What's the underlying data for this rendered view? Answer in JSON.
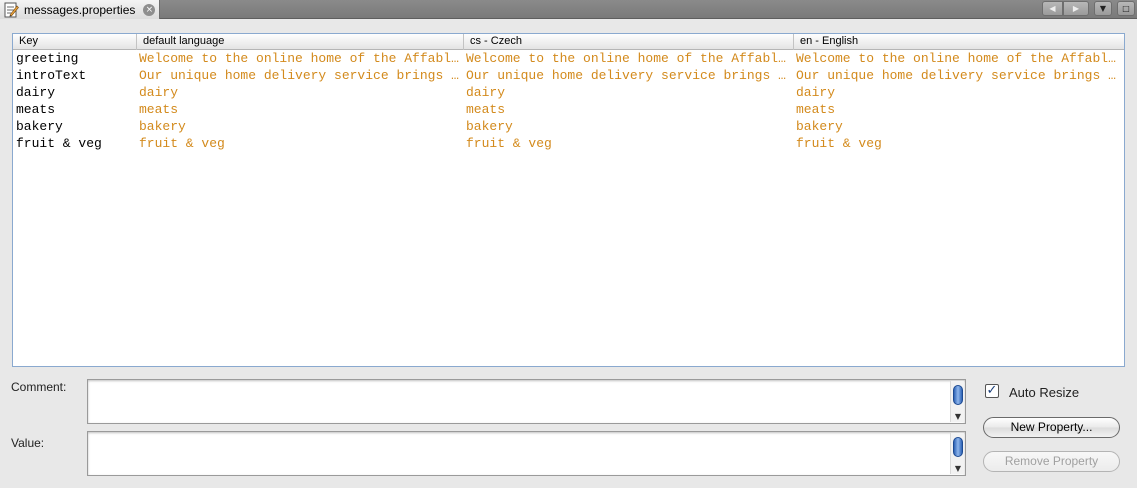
{
  "tab": {
    "title": "messages.properties",
    "close_glyph": "×",
    "icon": "properties-file-icon"
  },
  "tab_controls": {
    "prev": "◀",
    "next": "▶",
    "menu": "▼",
    "maximize": "□"
  },
  "table": {
    "columns": [
      "Key",
      "default language",
      "cs - Czech",
      "en - English"
    ],
    "rows": [
      [
        "greeting",
        "Welcome to the online home of the Affable Bean Green Grocer.",
        "Welcome to the online home of the Affable Bean Green Grocer.",
        "Welcome to the online home of the Affable Bean Green Grocer."
      ],
      [
        "introText",
        "Our unique home delivery service brings you fresh organic produce.",
        "Our unique home delivery service brings you fresh organic produce.",
        "Our unique home delivery service brings you fresh organic produce."
      ],
      [
        "dairy",
        "dairy",
        "dairy",
        "dairy"
      ],
      [
        "meats",
        "meats",
        "meats",
        "meats"
      ],
      [
        "bakery",
        "bakery",
        "bakery",
        "bakery"
      ],
      [
        "fruit & veg",
        "fruit & veg",
        "fruit & veg",
        "fruit & veg"
      ]
    ]
  },
  "form": {
    "comment_label": "Comment:",
    "comment_value": "",
    "value_label": "Value:",
    "value_value": "",
    "auto_resize_label": "Auto Resize",
    "auto_resize_checked": true,
    "new_property_label": "New Property...",
    "remove_property_label": "Remove Property"
  },
  "colors": {
    "value_text": "#d38a1c",
    "key_text": "#000000",
    "table_border": "#8aa9cf"
  }
}
